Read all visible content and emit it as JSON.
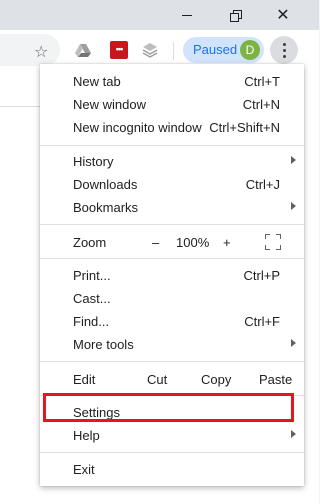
{
  "window": {
    "controls": [
      "minimize-icon",
      "maximize-icon",
      "close-icon"
    ]
  },
  "toolbar": {
    "extensions": [
      "drive-icon",
      "lastpass-icon",
      "layers-icon"
    ],
    "lastpass_text": "•••",
    "profile": {
      "label": "Paused",
      "avatar": "D",
      "accent": "#1a73e8",
      "avatar_color": "#7cb342"
    }
  },
  "menu": {
    "new_tab": {
      "label": "New tab",
      "shortcut": "Ctrl+T"
    },
    "new_window": {
      "label": "New window",
      "shortcut": "Ctrl+N"
    },
    "new_incognito": {
      "label": "New incognito window",
      "shortcut": "Ctrl+Shift+N"
    },
    "history": {
      "label": "History"
    },
    "downloads": {
      "label": "Downloads",
      "shortcut": "Ctrl+J"
    },
    "bookmarks": {
      "label": "Bookmarks"
    },
    "zoom": {
      "label": "Zoom",
      "minus": "–",
      "value": "100%",
      "plus": "+"
    },
    "print": {
      "label": "Print...",
      "shortcut": "Ctrl+P"
    },
    "cast": {
      "label": "Cast..."
    },
    "find": {
      "label": "Find...",
      "shortcut": "Ctrl+F"
    },
    "more_tools": {
      "label": "More tools"
    },
    "edit": {
      "label": "Edit",
      "cut": "Cut",
      "copy": "Copy",
      "paste": "Paste"
    },
    "settings": {
      "label": "Settings"
    },
    "help": {
      "label": "Help"
    },
    "exit": {
      "label": "Exit"
    }
  },
  "highlight": {
    "target": "Settings",
    "color": "#e0191e"
  }
}
